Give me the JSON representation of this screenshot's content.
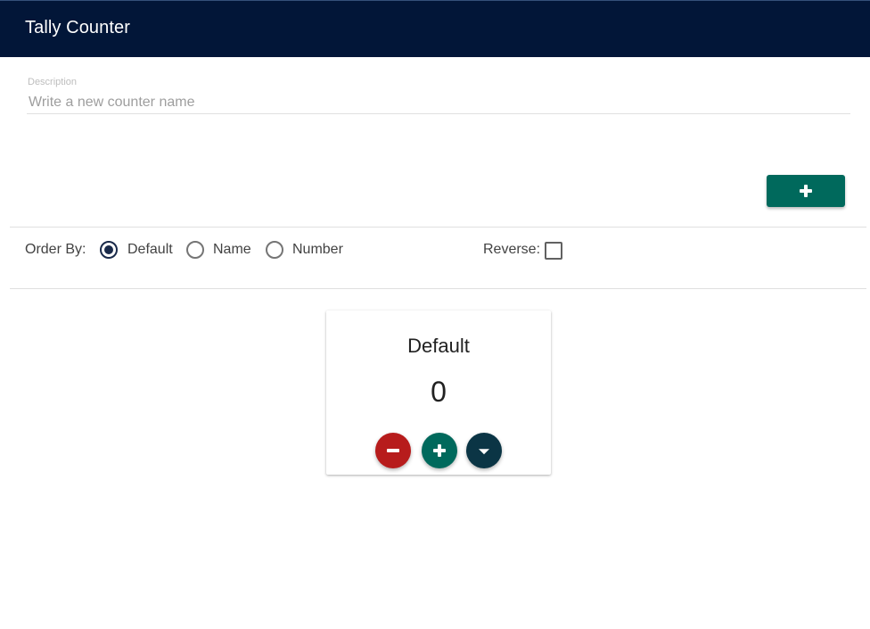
{
  "appbar": {
    "title": "Tally Counter",
    "background_color": "#021638"
  },
  "new_counter": {
    "field_label": "Description",
    "placeholder": "Write a new counter name",
    "value": "",
    "add_button_icon": "plus-icon",
    "add_button_color": "#00695c"
  },
  "sorting": {
    "order_by_label": "Order By:",
    "options": [
      {
        "label": "Default",
        "checked": true
      },
      {
        "label": "Name",
        "checked": false
      },
      {
        "label": "Number",
        "checked": false
      }
    ],
    "reverse_label": "Reverse:",
    "reverse_checked": false
  },
  "counters": [
    {
      "name": "Default",
      "count": "0",
      "decrement_icon": "minus-icon",
      "increment_icon": "plus-icon",
      "menu_icon": "caret-down-icon",
      "colors": {
        "decrement": "#b71c1c",
        "increment": "#00695c",
        "menu": "#0b3545"
      }
    }
  ]
}
